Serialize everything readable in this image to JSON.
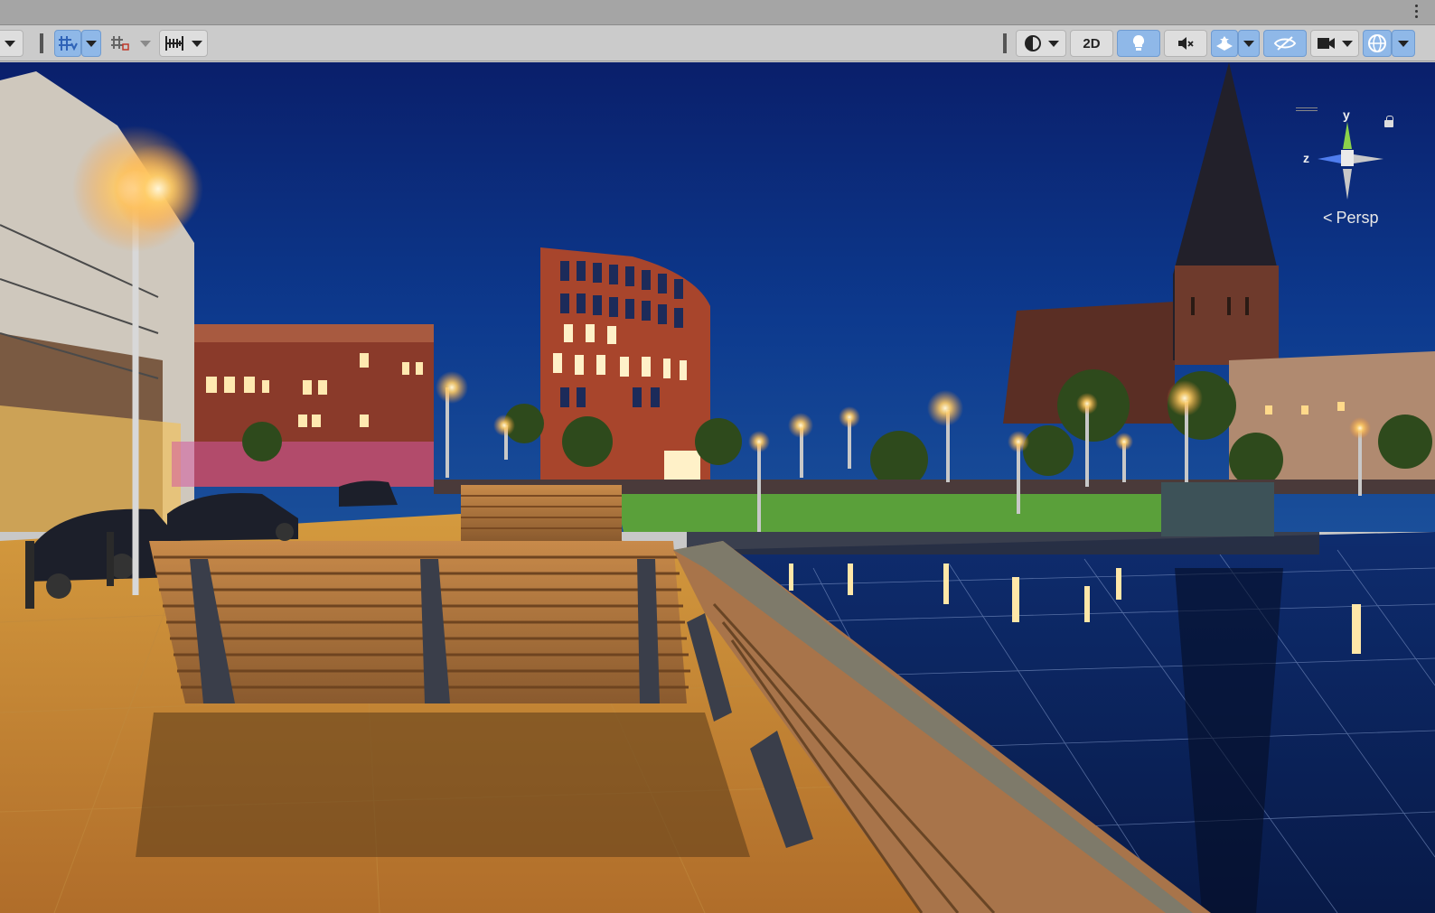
{
  "toolbar": {
    "left": {
      "view_dropdown": "view-dropdown",
      "grid_snap_toggle": "grid-snap-icon",
      "snap_increment_toggle": "snap-increment-icon",
      "ruler_toggle": "ruler-icon"
    },
    "right": {
      "shading_mode": "shading-sphere-icon",
      "mode_2d_label": "2D",
      "lighting_toggle": "lightbulb-icon",
      "audio_toggle": "audio-mute-icon",
      "effects_toggle": "effects-icon",
      "hidden_toggle": "hidden-eye-icon",
      "camera_toggle": "camera-icon",
      "gizmos_toggle": "gizmo-globe-icon"
    }
  },
  "viewport": {
    "projection_label": "Persp",
    "axis_labels": {
      "y": "y",
      "z": "z"
    }
  },
  "colors": {
    "active_button": "#8fb8e8",
    "toolbar_bg": "#cbcbcb",
    "titlebar_bg": "#a5a5a5",
    "axis_y": "#8cd34b",
    "axis_z": "#4f7dee",
    "axis_x": "#c8c8c8"
  }
}
